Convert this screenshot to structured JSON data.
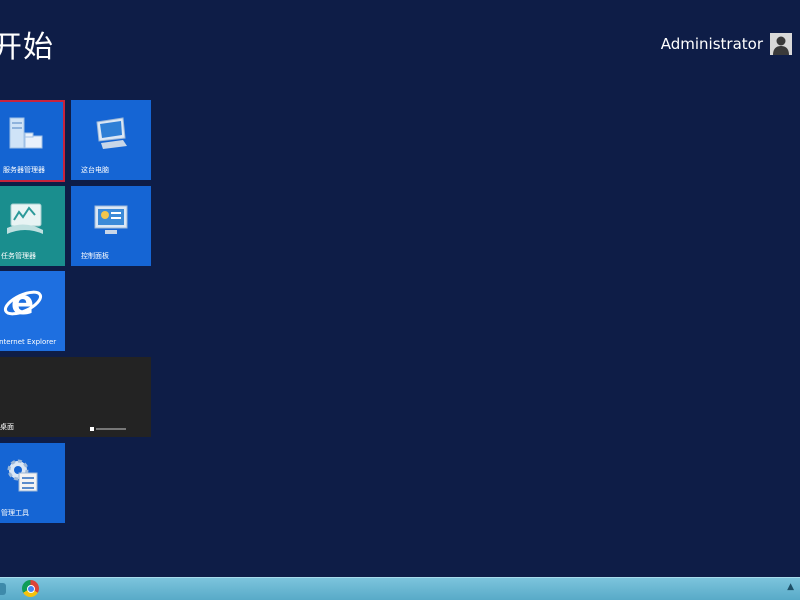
{
  "start": {
    "title": "开始"
  },
  "user": {
    "name": "Administrator"
  },
  "tiles": {
    "server_manager": {
      "label": "服务器管理器"
    },
    "computer": {
      "label": "这台电脑"
    },
    "task_manager": {
      "label": "任务管理器"
    },
    "control_panel": {
      "label": "控制面板"
    },
    "internet_explorer": {
      "label": "Internet Explorer"
    },
    "desktop": {
      "label": "桌面"
    },
    "admin_tools": {
      "label": "管理工具"
    }
  },
  "colors": {
    "background": "#0e1d47",
    "tile_blue": "#1565d4",
    "tile_teal": "#1a8e8e",
    "tile_desktop": "#232323",
    "selection_border": "#c8233c",
    "taskbar": "#6ab8d4"
  },
  "taskbar": {
    "icons": [
      "chrome-icon"
    ]
  }
}
